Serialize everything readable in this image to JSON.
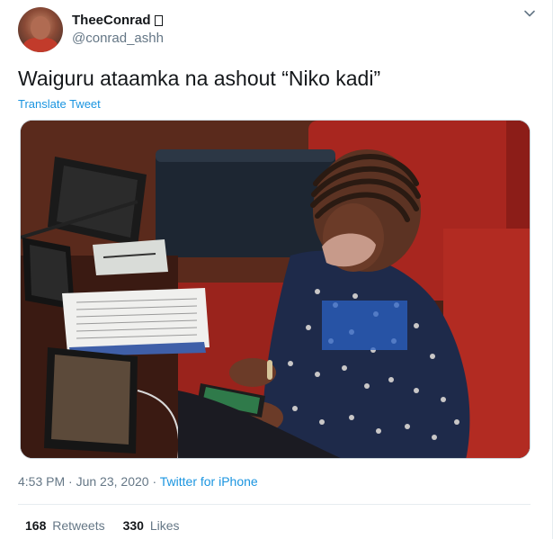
{
  "author": {
    "display_name": "TheeConrad",
    "badge_icon": "unrendered-glyph-box-icon",
    "handle": "@conrad_ashh"
  },
  "tweet": {
    "text": "Waiguru ataamka na ashout “Niko kadi”",
    "translate_label": "Translate Tweet",
    "time": "4:53 PM",
    "separator": "·",
    "date": "Jun 23, 2020",
    "source": "Twitter for iPhone"
  },
  "stats": {
    "retweets_count": "168",
    "retweets_label": "Retweets",
    "likes_count": "330",
    "likes_label": "Likes"
  },
  "colors": {
    "link": "#1b95e0",
    "muted_text": "#657786",
    "primary_text": "#14171a",
    "divider": "#e6ecf0",
    "seat_red": "#a8261f"
  }
}
